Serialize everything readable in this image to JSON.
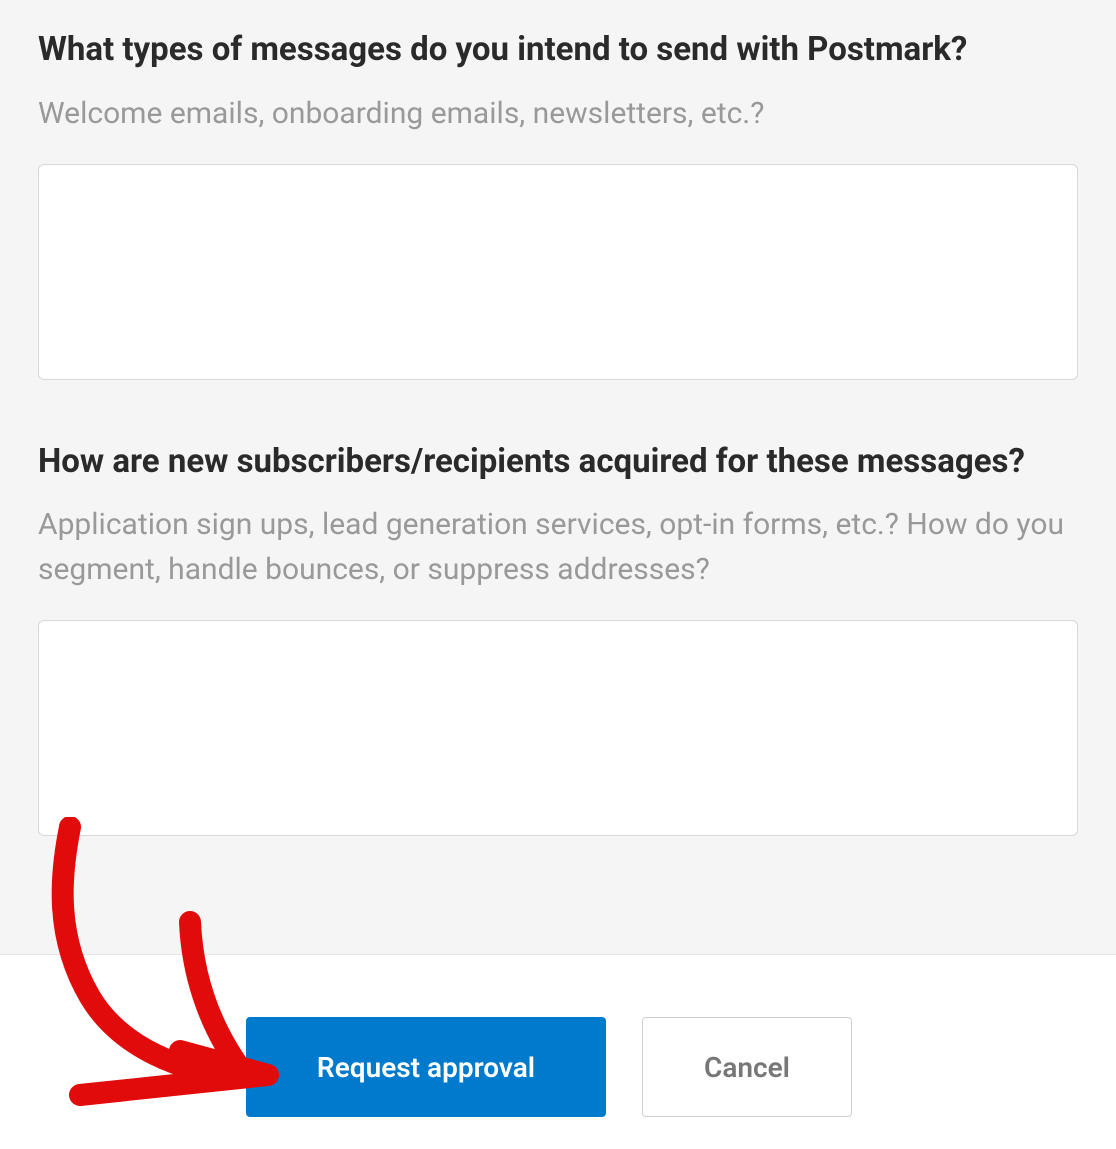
{
  "form": {
    "question1": {
      "label": "What types of messages do you intend to send with Postmark?",
      "hint": "Welcome emails, onboarding emails, newsletters, etc.?",
      "value": ""
    },
    "question2": {
      "label": "How are new subscribers/recipients acquired for these messages?",
      "hint": "Application sign ups, lead generation services, opt-in forms, etc.? How do you segment, handle bounces, or suppress addresses?",
      "value": ""
    }
  },
  "footer": {
    "primary_label": "Request approval",
    "secondary_label": "Cancel"
  },
  "annotation": {
    "color": "#e20b0b"
  }
}
